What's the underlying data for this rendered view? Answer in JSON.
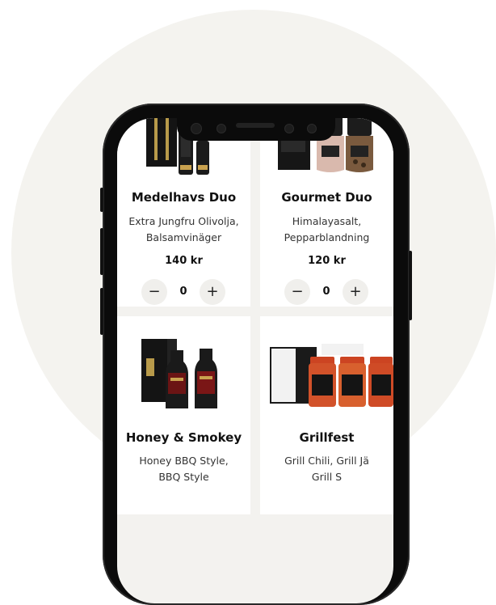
{
  "products": [
    {
      "name": "Medelhavs Duo",
      "desc_lines": [
        "Extra Jungfru Olivolja,",
        "Balsamvinäger"
      ],
      "price": "140 kr",
      "qty": "0"
    },
    {
      "name": "Gourmet Duo",
      "desc_lines": [
        "Himalayasalt,",
        "Pepparblandning"
      ],
      "price": "120 kr",
      "qty": "0"
    },
    {
      "name": "Honey & Smokey",
      "desc_lines": [
        "Honey BBQ Style,",
        "BBQ Style"
      ],
      "price": "",
      "qty": ""
    },
    {
      "name": "Grillfest",
      "desc_lines": [
        "Grill Chili, Grill Jä",
        "Grill S"
      ],
      "price": "",
      "qty": ""
    }
  ],
  "controls": {
    "minus": "−",
    "plus": "+"
  },
  "icons": [
    "oil-bottle-icon",
    "grinder-icon",
    "bbq-sauce-icon",
    "spice-jar-icon",
    "minus-icon",
    "plus-icon"
  ],
  "colors": {
    "background": "#f4f3ef",
    "card": "#ffffff",
    "phone": "#0b0b0b",
    "button": "#f0efec"
  }
}
